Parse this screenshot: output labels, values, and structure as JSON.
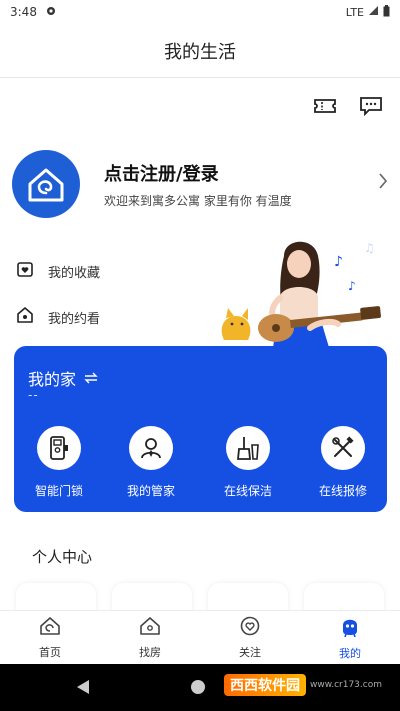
{
  "status_bar": {
    "time": "3:48",
    "network": "LTE"
  },
  "header": {
    "title": "我的生活"
  },
  "profile": {
    "name": "点击注册/登录",
    "subtitle": "欢迎来到寓多公寓 家里有你 有温度"
  },
  "links": [
    {
      "label": "我的收藏",
      "icon": "heart-folder-icon"
    },
    {
      "label": "我的约看",
      "icon": "house-eye-icon"
    }
  ],
  "home_card": {
    "title": "我的家",
    "subtitle": "--",
    "services": [
      {
        "label": "智能门锁",
        "icon": "smart-lock-icon"
      },
      {
        "label": "我的管家",
        "icon": "steward-icon"
      },
      {
        "label": "在线保洁",
        "icon": "cleaning-icon"
      },
      {
        "label": "在线报修",
        "icon": "repair-icon"
      }
    ]
  },
  "personal_center": {
    "title": "个人中心"
  },
  "tabs": [
    {
      "label": "首页",
      "icon": "home-snail-icon"
    },
    {
      "label": "找房",
      "icon": "house-icon"
    },
    {
      "label": "关注",
      "icon": "heart-icon"
    },
    {
      "label": "我的",
      "icon": "user-icon"
    }
  ],
  "watermark": {
    "brand": "西西软件园",
    "url": "www.cr173.com"
  },
  "colors": {
    "accent": "#1550e3"
  }
}
